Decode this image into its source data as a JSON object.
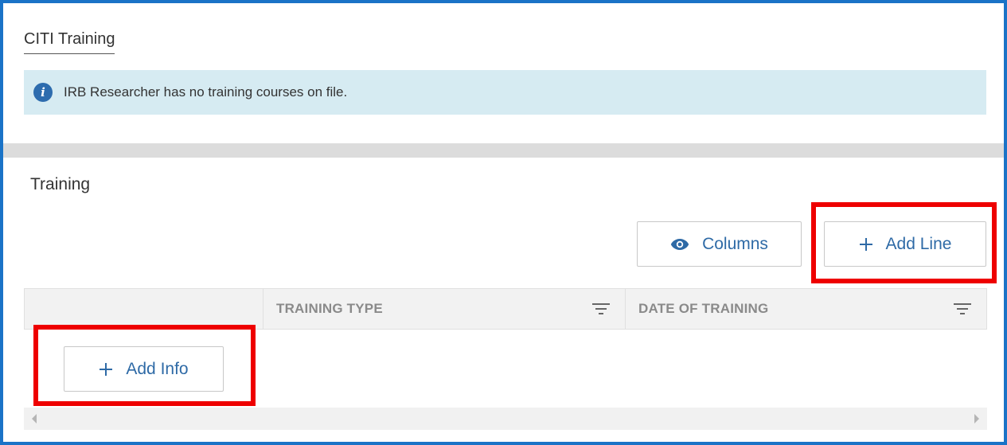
{
  "citi": {
    "title": "CITI Training",
    "info_message": "IRB Researcher has no training courses on file."
  },
  "training": {
    "title": "Training",
    "columns_button": "Columns",
    "add_line_button": "Add Line",
    "add_info_button": "Add Info",
    "table": {
      "columns": [
        "",
        "TRAINING TYPE",
        "DATE OF TRAINING"
      ],
      "rows": []
    }
  },
  "icons": {
    "info": "info-icon",
    "columns": "eye-icon",
    "add": "plus-icon",
    "filter": "filter-icon"
  },
  "colors": {
    "frame_border": "#1a73c7",
    "highlight": "#ee0000",
    "link_blue": "#2e6aa6",
    "info_bg": "#d6ebf2"
  }
}
